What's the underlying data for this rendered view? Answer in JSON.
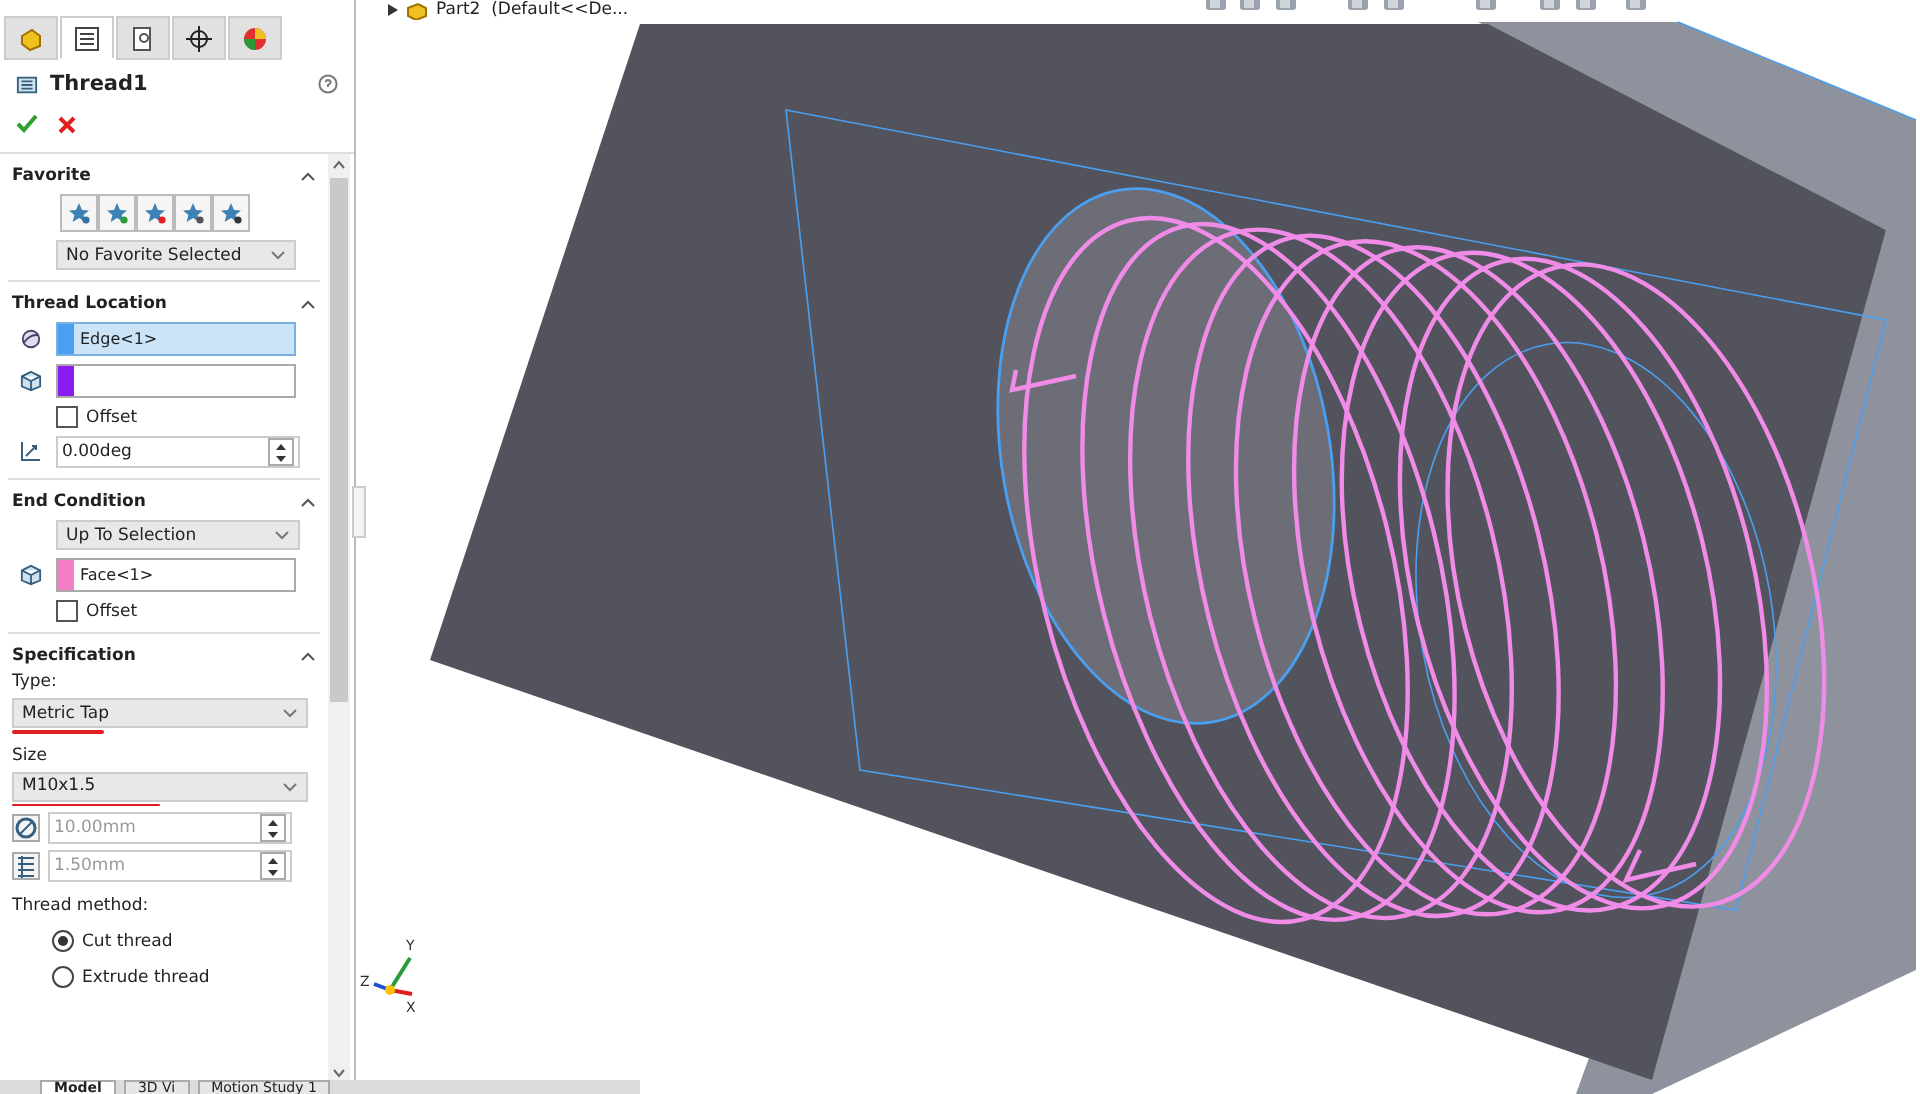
{
  "panel_tabs": [
    {
      "selected": false
    },
    {
      "selected": true
    },
    {
      "selected": false
    },
    {
      "selected": false
    },
    {
      "selected": false
    }
  ],
  "feature": {
    "title": "Thread1"
  },
  "favorite": {
    "title": "Favorite",
    "expanded": true,
    "dropdown": "No Favorite Selected"
  },
  "thread_location": {
    "title": "Thread Location",
    "expanded": true,
    "edge": {
      "value": "Edge<1>",
      "color": "#4a9ff0",
      "selected": true
    },
    "second": {
      "color": "#8b1cf0",
      "selected": false
    },
    "offset": {
      "label": "Offset",
      "checked": false
    },
    "angle": "0.00deg"
  },
  "end_condition": {
    "title": "End Condition",
    "expanded": true,
    "dropdown": "Up To Selection",
    "face": {
      "value": "Face<1>",
      "color": "#f27fc4",
      "selected": false
    },
    "offset": {
      "label": "Offset",
      "checked": false
    }
  },
  "specification": {
    "title": "Specification",
    "expanded": true,
    "type_label": "Type:",
    "type": "Metric Tap",
    "size_label": "Size",
    "size": "M10x1.5",
    "diameter": "10.00mm",
    "pitch": "1.50mm",
    "method_label": "Thread method:",
    "methods": [
      {
        "label": "Cut thread",
        "selected": true
      },
      {
        "label": "Extrude thread",
        "selected": false
      }
    ]
  },
  "viewport": {
    "tree_item": "Part2  (Default<<De...",
    "axes": {
      "x": "X",
      "y": "Y",
      "z": "Z"
    }
  },
  "bottom_tabs": [
    {
      "label": "Model",
      "selected": true
    },
    {
      "label": "3D Vi",
      "selected": false
    },
    {
      "label": "Motion Study 1",
      "selected": false
    }
  ]
}
